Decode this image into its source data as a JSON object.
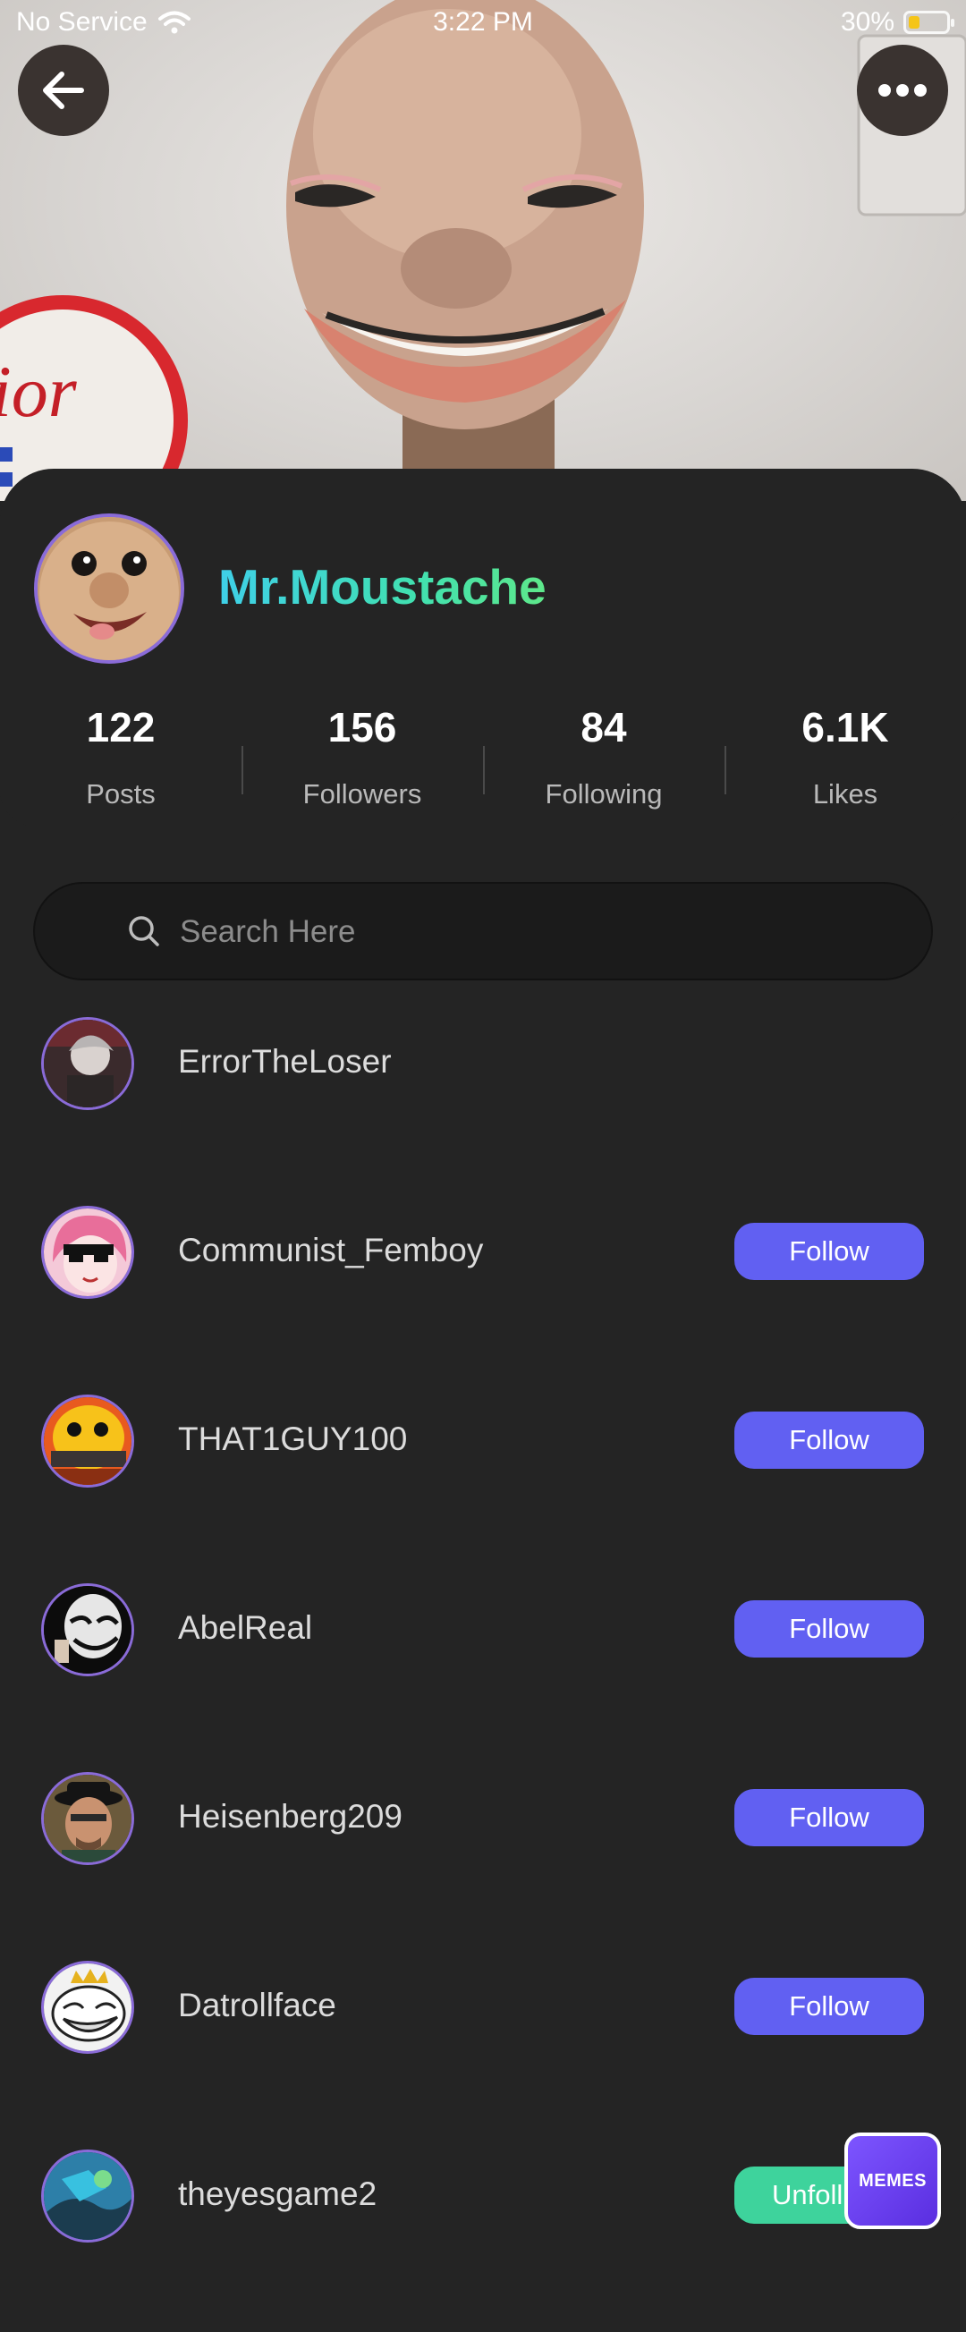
{
  "status_bar": {
    "carrier": "No Service",
    "time": "3:22 PM",
    "battery": "30%"
  },
  "profile": {
    "username": "Mr.Moustache"
  },
  "stats": [
    {
      "value": "122",
      "label": "Posts"
    },
    {
      "value": "156",
      "label": "Followers"
    },
    {
      "value": "84",
      "label": "Following"
    },
    {
      "value": "6.1K",
      "label": "Likes"
    }
  ],
  "search": {
    "placeholder": "Search Here"
  },
  "users": [
    {
      "name": "ErrorTheLoser",
      "action": ""
    },
    {
      "name": "Communist_Femboy",
      "action": "Follow"
    },
    {
      "name": "THAT1GUY100",
      "action": "Follow"
    },
    {
      "name": "AbelReal",
      "action": "Follow"
    },
    {
      "name": "Heisenberg209",
      "action": "Follow"
    },
    {
      "name": "Datrollface",
      "action": "Follow"
    },
    {
      "name": "theyesgame2",
      "action": "Unfoll"
    }
  ],
  "badge": {
    "label": "MEMES"
  },
  "colors": {
    "accent": "#6160f2",
    "unfollow": "#3ed39c",
    "avatar_ring": "#8a6bd8",
    "background": "#242424"
  }
}
